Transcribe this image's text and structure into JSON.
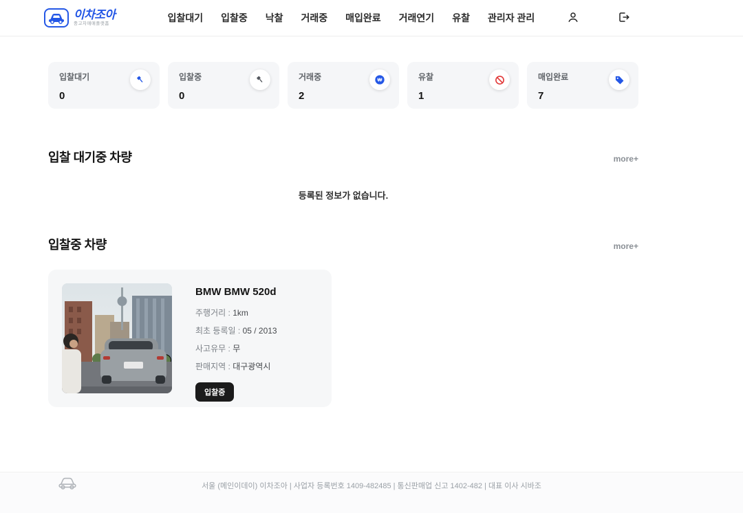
{
  "colors": {
    "accent": "#2457e6",
    "danger": "#e23b3b",
    "badge_bg": "#1b1b1b",
    "card_bg": "#f5f6f8"
  },
  "header": {
    "logo": {
      "title": "이차조아",
      "subtitle": "중고차매매플랫폼"
    },
    "nav": [
      "입찰대기",
      "입찰중",
      "낙찰",
      "거래중",
      "매입완료",
      "거래연기",
      "유찰",
      "관리자 관리"
    ]
  },
  "stats": [
    {
      "label": "입찰대기",
      "value": "0",
      "icon": "gavel-icon-blue"
    },
    {
      "label": "입찰중",
      "value": "0",
      "icon": "gavel-icon-gray"
    },
    {
      "label": "거래중",
      "value": "2",
      "icon": "coin-icon-blue"
    },
    {
      "label": "유찰",
      "value": "1",
      "icon": "no-sign-icon-red"
    },
    {
      "label": "매입완료",
      "value": "7",
      "icon": "tag-icon-blue"
    }
  ],
  "sections": {
    "waiting": {
      "title": "입찰 대기중 차량",
      "more": "more+",
      "empty": "등록된 정보가 없습니다."
    },
    "bidding": {
      "title": "입찰중 차량",
      "more": "more+"
    }
  },
  "car": {
    "title": "BMW BMW 520d",
    "detail_separator": " : ",
    "details": [
      {
        "label": "주행거리",
        "value": "1km"
      },
      {
        "label": "최초 등록일",
        "value": "05 / 2013"
      },
      {
        "label": "사고유무",
        "value": "무"
      },
      {
        "label": "판매지역",
        "value": "대구광역시"
      }
    ],
    "badge": "입찰중"
  },
  "footer": {
    "text": "서울 (메인이데이) 이차조아  |  사업자 등록번호 1409-482485  |  통신판매업 신고 1402-482  |  대표 이사 시바조"
  }
}
